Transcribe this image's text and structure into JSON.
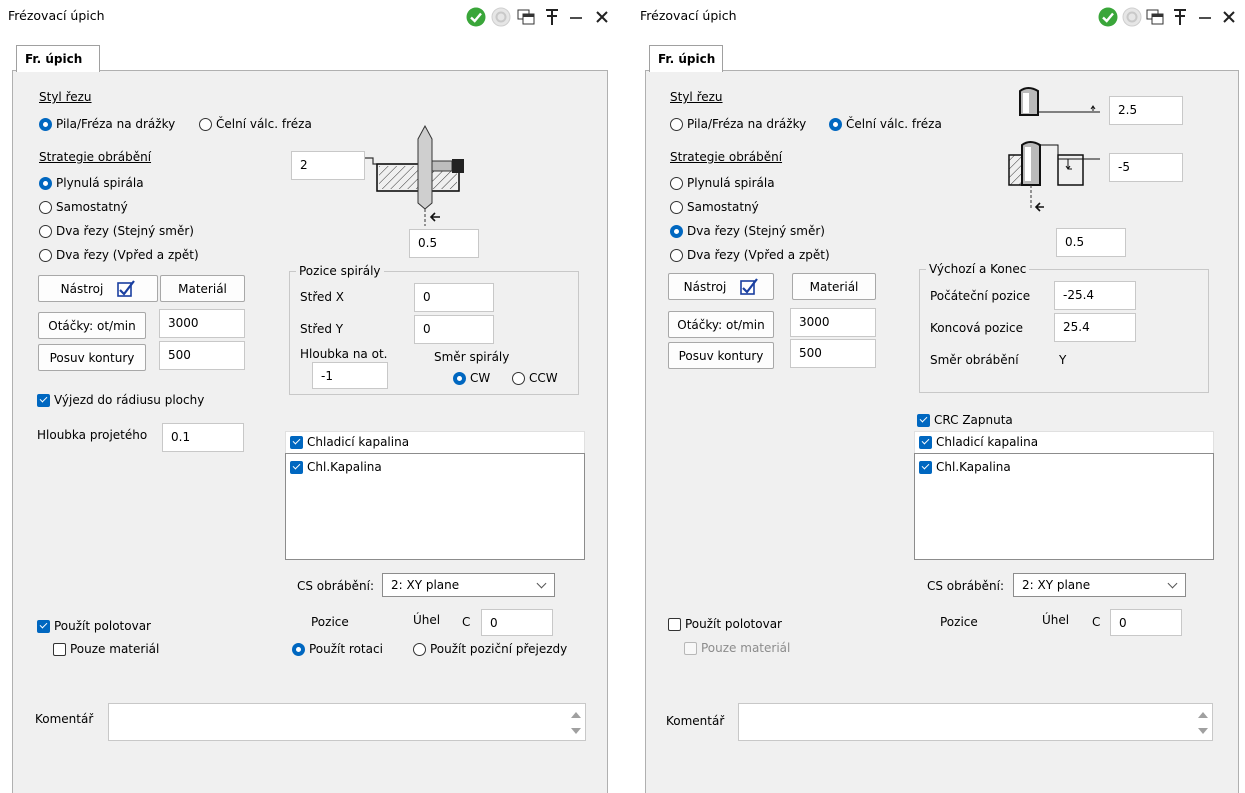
{
  "left": {
    "title": "Frézovací úpich",
    "tab": "Fr. úpich",
    "cut_style_label": "Styl řezu",
    "cut_style_options": [
      "Pila/Fréza na drážky",
      "Čelní válc. fréza"
    ],
    "strategy_label": "Strategie obrábění",
    "strategy_options": [
      "Plynulá spirála",
      "Samostatný",
      "Dva řezy (Stejný směr)",
      "Dva řezy (Vpřed a zpět)"
    ],
    "tool_button": "Nástroj",
    "material_button": "Materiál",
    "speed_button": "Otáčky: ot/min",
    "speed_value": "3000",
    "feed_button": "Posuv kontury",
    "feed_value": "500",
    "diagram_top_value": "2",
    "diagram_bottom_value": "0.5",
    "spiral_group_label": "Pozice spirály",
    "center_x_label": "Střed X",
    "center_x_value": "0",
    "center_y_label": "Střed Y",
    "center_y_value": "0",
    "depth_per_rev_label": "Hloubka na ot.",
    "depth_per_rev_value": "-1",
    "spiral_dir_label": "Směr spirály",
    "spiral_dir_options": [
      "CW",
      "CCW"
    ],
    "exit_radius_label": "Výjezd do rádiusu plochy",
    "pass_depth_label": "Hloubka projetého",
    "pass_depth_value": "0.1",
    "coolant_label": "Chladicí kapalina",
    "coolant_item": "Chl.Kapalina",
    "cs_label": "CS obrábění:",
    "cs_value": "2: XY plane",
    "use_stock_label": "Použít polotovar",
    "material_only_label": "Pouze materiál",
    "position_label": "Pozice",
    "angle_label": "Úhel",
    "axis_label": "C",
    "angle_value": "0",
    "position_options": [
      "Použít rotaci",
      "Použít poziční přejezdy"
    ],
    "comment_label": "Komentář"
  },
  "right": {
    "title": "Frézovací úpich",
    "tab": "Fr. úpich",
    "cut_style_label": "Styl řezu",
    "cut_style_options": [
      "Pila/Fréza na drážky",
      "Čelní válc. fréza"
    ],
    "strategy_label": "Strategie obrábění",
    "strategy_options": [
      "Plynulá spirála",
      "Samostatný",
      "Dva řezy (Stejný směr)",
      "Dva řezy (Vpřed a zpět)"
    ],
    "tool_button": "Nástroj",
    "material_button": "Materiál",
    "speed_button": "Otáčky: ot/min",
    "speed_value": "3000",
    "feed_button": "Posuv kontury",
    "feed_value": "500",
    "diagram_top_value": "2.5",
    "diagram_mid_value": "-5",
    "diagram_bottom_value": "0.5",
    "start_end_group_label": "Výchozí a Konec",
    "start_pos_label": "Počáteční pozice",
    "start_pos_value": "-25.4",
    "end_pos_label": "Koncová pozice",
    "end_pos_value": "25.4",
    "machining_dir_label": "Směr obrábění",
    "machining_dir_value": "Y",
    "crc_label": "CRC Zapnuta",
    "coolant_label": "Chladicí kapalina",
    "coolant_item": "Chl.Kapalina",
    "cs_label": "CS obrábění:",
    "cs_value": "2: XY plane",
    "use_stock_label": "Použít polotovar",
    "material_only_label": "Pouze materiál",
    "position_label": "Pozice",
    "angle_label": "Úhel",
    "axis_label": "C",
    "angle_value": "0",
    "comment_label": "Komentář"
  },
  "colors": {
    "accent": "#0067c0",
    "ok_green": "#3aa63a",
    "panel_bg": "#f0f0f0"
  }
}
